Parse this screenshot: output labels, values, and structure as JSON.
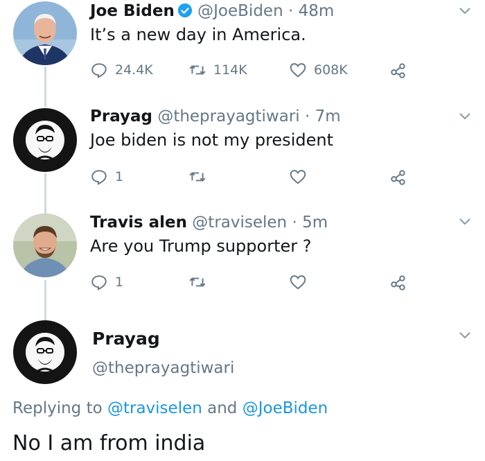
{
  "tweets": [
    {
      "name": "Joe Biden",
      "handle": "@JoeBiden",
      "dot": "·",
      "time": "48m",
      "verified": true,
      "text": "It’s a new day in America.",
      "replies": "24.4K",
      "retweets": "114K",
      "likes": "608K"
    },
    {
      "name": "Prayag",
      "handle": "@theprayagtiwari",
      "dot": "·",
      "time": "7m",
      "text": "Joe biden is not my president",
      "replies": "1"
    },
    {
      "name": "Travis alen",
      "handle": "@traviselen",
      "dot": "·",
      "time": "5m",
      "text": "Are you Trump supporter ?",
      "replies": "1"
    }
  ],
  "focused": {
    "name": "Prayag",
    "handle": "@theprayagtiwari",
    "replying_prefix": "Replying to",
    "replying_user1": "@traviselen",
    "replying_and": "and",
    "replying_user2": "@JoeBiden",
    "text": "No I am from india"
  },
  "colors": {
    "link": "#1b95e0",
    "muted": "#657786",
    "verified": "#1da1f2",
    "thread_line": "#cfd9de"
  },
  "icons": [
    "chevron-down-icon",
    "verified-badge-icon",
    "reply-icon",
    "retweet-icon",
    "like-icon",
    "share-icon"
  ]
}
